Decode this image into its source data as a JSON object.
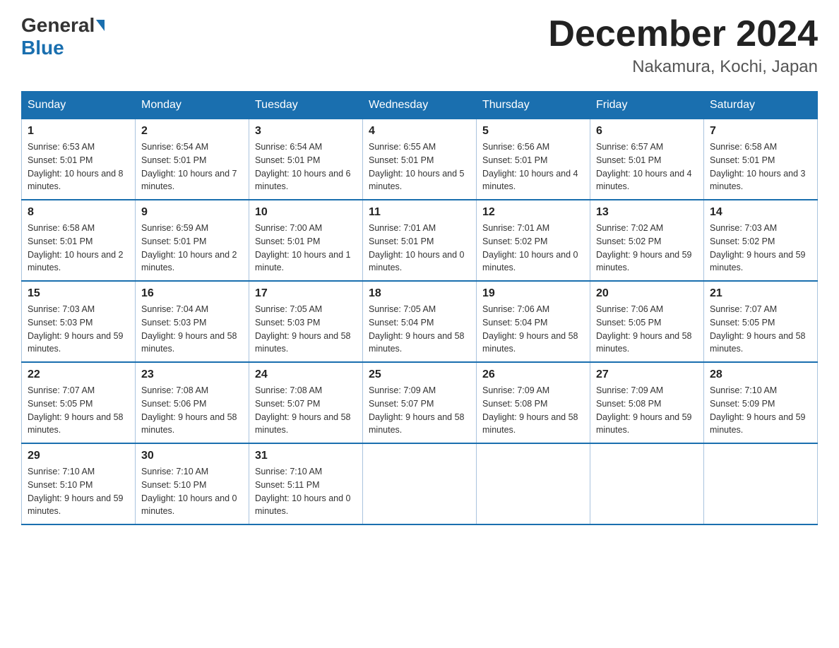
{
  "header": {
    "logo_general": "General",
    "logo_blue": "Blue",
    "month_title": "December 2024",
    "location": "Nakamura, Kochi, Japan"
  },
  "days_of_week": [
    "Sunday",
    "Monday",
    "Tuesday",
    "Wednesday",
    "Thursday",
    "Friday",
    "Saturday"
  ],
  "weeks": [
    [
      {
        "day": "1",
        "sunrise": "6:53 AM",
        "sunset": "5:01 PM",
        "daylight": "10 hours and 8 minutes."
      },
      {
        "day": "2",
        "sunrise": "6:54 AM",
        "sunset": "5:01 PM",
        "daylight": "10 hours and 7 minutes."
      },
      {
        "day": "3",
        "sunrise": "6:54 AM",
        "sunset": "5:01 PM",
        "daylight": "10 hours and 6 minutes."
      },
      {
        "day": "4",
        "sunrise": "6:55 AM",
        "sunset": "5:01 PM",
        "daylight": "10 hours and 5 minutes."
      },
      {
        "day": "5",
        "sunrise": "6:56 AM",
        "sunset": "5:01 PM",
        "daylight": "10 hours and 4 minutes."
      },
      {
        "day": "6",
        "sunrise": "6:57 AM",
        "sunset": "5:01 PM",
        "daylight": "10 hours and 4 minutes."
      },
      {
        "day": "7",
        "sunrise": "6:58 AM",
        "sunset": "5:01 PM",
        "daylight": "10 hours and 3 minutes."
      }
    ],
    [
      {
        "day": "8",
        "sunrise": "6:58 AM",
        "sunset": "5:01 PM",
        "daylight": "10 hours and 2 minutes."
      },
      {
        "day": "9",
        "sunrise": "6:59 AM",
        "sunset": "5:01 PM",
        "daylight": "10 hours and 2 minutes."
      },
      {
        "day": "10",
        "sunrise": "7:00 AM",
        "sunset": "5:01 PM",
        "daylight": "10 hours and 1 minute."
      },
      {
        "day": "11",
        "sunrise": "7:01 AM",
        "sunset": "5:01 PM",
        "daylight": "10 hours and 0 minutes."
      },
      {
        "day": "12",
        "sunrise": "7:01 AM",
        "sunset": "5:02 PM",
        "daylight": "10 hours and 0 minutes."
      },
      {
        "day": "13",
        "sunrise": "7:02 AM",
        "sunset": "5:02 PM",
        "daylight": "9 hours and 59 minutes."
      },
      {
        "day": "14",
        "sunrise": "7:03 AM",
        "sunset": "5:02 PM",
        "daylight": "9 hours and 59 minutes."
      }
    ],
    [
      {
        "day": "15",
        "sunrise": "7:03 AM",
        "sunset": "5:03 PM",
        "daylight": "9 hours and 59 minutes."
      },
      {
        "day": "16",
        "sunrise": "7:04 AM",
        "sunset": "5:03 PM",
        "daylight": "9 hours and 58 minutes."
      },
      {
        "day": "17",
        "sunrise": "7:05 AM",
        "sunset": "5:03 PM",
        "daylight": "9 hours and 58 minutes."
      },
      {
        "day": "18",
        "sunrise": "7:05 AM",
        "sunset": "5:04 PM",
        "daylight": "9 hours and 58 minutes."
      },
      {
        "day": "19",
        "sunrise": "7:06 AM",
        "sunset": "5:04 PM",
        "daylight": "9 hours and 58 minutes."
      },
      {
        "day": "20",
        "sunrise": "7:06 AM",
        "sunset": "5:05 PM",
        "daylight": "9 hours and 58 minutes."
      },
      {
        "day": "21",
        "sunrise": "7:07 AM",
        "sunset": "5:05 PM",
        "daylight": "9 hours and 58 minutes."
      }
    ],
    [
      {
        "day": "22",
        "sunrise": "7:07 AM",
        "sunset": "5:05 PM",
        "daylight": "9 hours and 58 minutes."
      },
      {
        "day": "23",
        "sunrise": "7:08 AM",
        "sunset": "5:06 PM",
        "daylight": "9 hours and 58 minutes."
      },
      {
        "day": "24",
        "sunrise": "7:08 AM",
        "sunset": "5:07 PM",
        "daylight": "9 hours and 58 minutes."
      },
      {
        "day": "25",
        "sunrise": "7:09 AM",
        "sunset": "5:07 PM",
        "daylight": "9 hours and 58 minutes."
      },
      {
        "day": "26",
        "sunrise": "7:09 AM",
        "sunset": "5:08 PM",
        "daylight": "9 hours and 58 minutes."
      },
      {
        "day": "27",
        "sunrise": "7:09 AM",
        "sunset": "5:08 PM",
        "daylight": "9 hours and 59 minutes."
      },
      {
        "day": "28",
        "sunrise": "7:10 AM",
        "sunset": "5:09 PM",
        "daylight": "9 hours and 59 minutes."
      }
    ],
    [
      {
        "day": "29",
        "sunrise": "7:10 AM",
        "sunset": "5:10 PM",
        "daylight": "9 hours and 59 minutes."
      },
      {
        "day": "30",
        "sunrise": "7:10 AM",
        "sunset": "5:10 PM",
        "daylight": "10 hours and 0 minutes."
      },
      {
        "day": "31",
        "sunrise": "7:10 AM",
        "sunset": "5:11 PM",
        "daylight": "10 hours and 0 minutes."
      },
      null,
      null,
      null,
      null
    ]
  ]
}
